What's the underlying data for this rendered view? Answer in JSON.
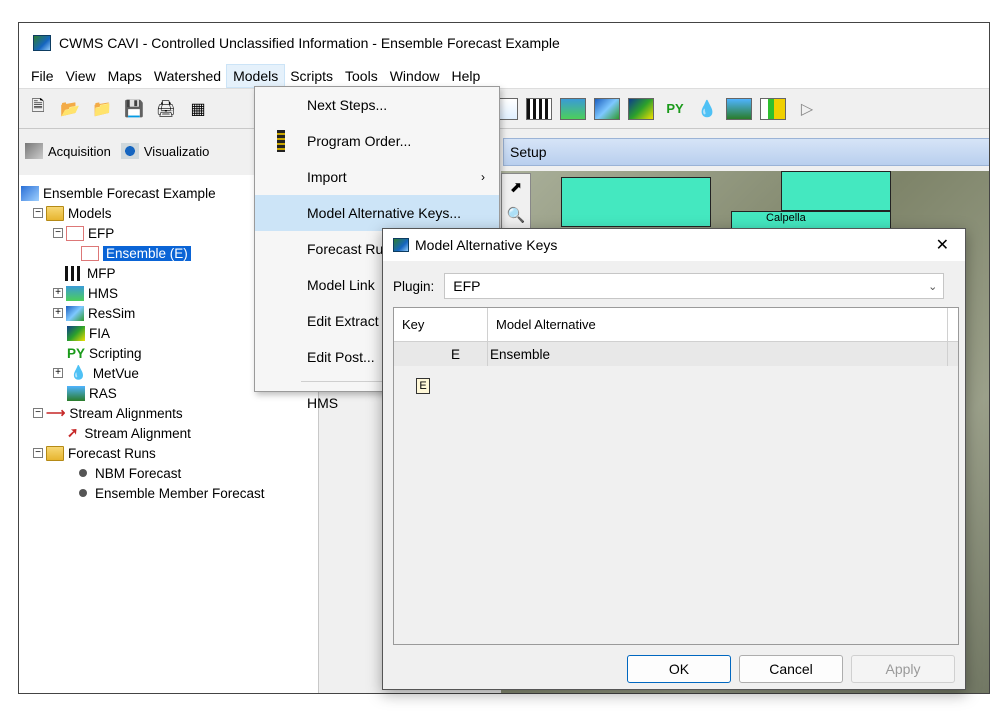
{
  "window": {
    "title": "CWMS CAVI - Controlled Unclassified Information - Ensemble Forecast Example"
  },
  "menu": [
    "File",
    "View",
    "Maps",
    "Watershed",
    "Models",
    "Scripts",
    "Tools",
    "Window",
    "Help"
  ],
  "toolbar": {
    "icons": [
      "new-icon",
      "open-icon",
      "folder-icon",
      "save-icon",
      "print-icon",
      "network-icon",
      "gear-icon",
      "efp-plugin-icon",
      "mfp-plugin-icon",
      "hms-plugin-icon",
      "ressim-plugin-icon",
      "fia-plugin-icon",
      "scripting-plugin-icon",
      "metvue-plugin-icon",
      "ras-plugin-icon",
      "chart-plugin-icon",
      "play-icon"
    ],
    "py_label": "PY"
  },
  "tabs": {
    "acquisition": "Acquisition",
    "visualization": "Visualizatio"
  },
  "tree": {
    "root": "Ensemble Forecast Example",
    "models": "Models",
    "efp": "EFP",
    "ensemble": "Ensemble (E)",
    "mfp": "MFP",
    "hms": "HMS",
    "ressim": "ResSim",
    "fia": "FIA",
    "scripting": "Scripting",
    "py": "PY",
    "metvue": "MetVue",
    "ras": "RAS",
    "stream_alignments": "Stream Alignments",
    "stream_alignment": "Stream Alignment",
    "forecast_runs": "Forecast Runs",
    "nbm_forecast": "NBM Forecast",
    "ensemble_member_forecast": "Ensemble Member Forecast"
  },
  "setup_label": "Setup",
  "map": {
    "place": "Calpella"
  },
  "models_menu": {
    "next_steps": "Next Steps...",
    "program_order": "Program Order...",
    "import": "Import",
    "model_alternative_keys": "Model Alternative Keys...",
    "forecast_ru": "Forecast Ru",
    "model_link": "Model Link",
    "edit_extract": "Edit Extract",
    "edit_post": "Edit Post...",
    "hms": "HMS"
  },
  "dialog": {
    "title": "Model Alternative Keys",
    "close": "✕",
    "plugin_label": "Plugin:",
    "plugin_value": "EFP",
    "columns": {
      "key": "Key",
      "alternative": "Model Alternative"
    },
    "rows": [
      {
        "key": "E",
        "alternative": "Ensemble"
      }
    ],
    "chip": "E",
    "buttons": {
      "ok": "OK",
      "cancel": "Cancel",
      "apply": "Apply"
    }
  }
}
